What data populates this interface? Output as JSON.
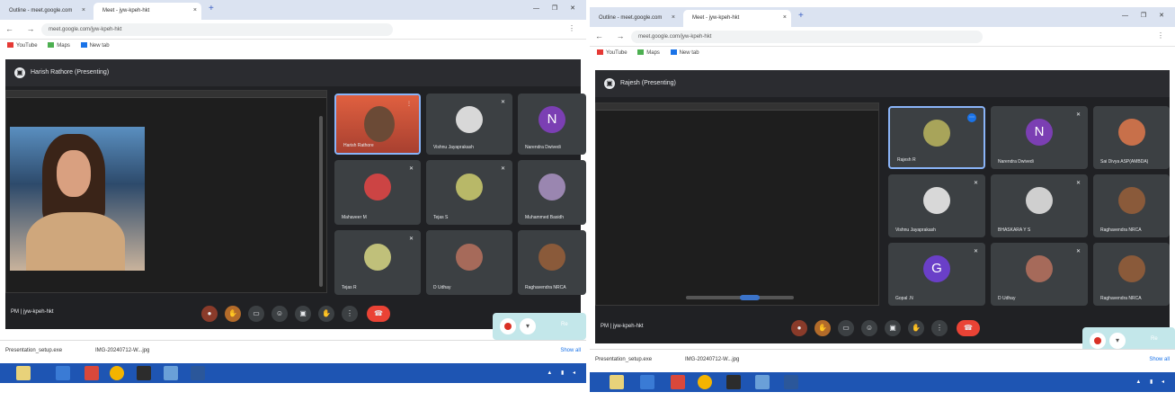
{
  "left": {
    "tabs": [
      {
        "label": "Outline - meet.google.com",
        "active": false
      },
      {
        "label": "Meet - jyw-kpeh-hkt",
        "active": true
      }
    ],
    "url": "meet.google.com/jyw-kpeh-hkt",
    "bookmarks": [
      "YouTube",
      "Maps",
      "New tab"
    ],
    "presenter_title": "Harish Rathore (Presenting)",
    "participants": [
      {
        "name": "Harish Rathore",
        "selected": true
      },
      {
        "name": "Vishnu Jayaprakash",
        "selected": false
      },
      {
        "name": "Narendra Dwivedi",
        "selected": false,
        "initial": "N",
        "color": "#7b3fb3"
      },
      {
        "name": "Mahaveer M",
        "selected": false
      },
      {
        "name": "Tejas S",
        "selected": false
      },
      {
        "name": "Muhammed Basidh",
        "selected": false
      },
      {
        "name": "Tejas R",
        "selected": false
      },
      {
        "name": "D Udhay",
        "selected": false
      },
      {
        "name": "Raghavendra NRCA",
        "selected": false
      }
    ],
    "meeting_code": "PM | jyw-kpeh-hkt",
    "recording_label": "Re",
    "download": "Presentation_setup.exe",
    "download2": "IMG-20240712-W...jpg",
    "show_all": "Show all"
  },
  "right": {
    "tabs": [
      {
        "label": "Outline - meet.google.com",
        "active": false
      },
      {
        "label": "Meet - jyw-kpeh-hkt",
        "active": true
      }
    ],
    "url": "meet.google.com/jyw-kpeh-hkt",
    "bookmarks": [
      "YouTube",
      "Maps",
      "New tab"
    ],
    "presenter_title": "Rajesh (Presenting)",
    "participants": [
      {
        "name": "Rajesh R",
        "selected": true
      },
      {
        "name": "Narendra Dwivedi",
        "selected": false,
        "initial": "N",
        "color": "#7b3fb3"
      },
      {
        "name": "Sai Divya ASP(AMBDA)",
        "selected": false
      },
      {
        "name": "Vishnu Jayaprakash",
        "selected": false
      },
      {
        "name": "BHASKARA Y S",
        "selected": false
      },
      {
        "name": "Raghavendra NRCA",
        "selected": false
      },
      {
        "name": "Gopal .N",
        "selected": false,
        "initial": "G",
        "color": "#6a3fc8"
      },
      {
        "name": "D Udhay",
        "selected": false
      },
      {
        "name": "Raghavendra NRCA",
        "selected": false
      }
    ],
    "meeting_code": "PM | jyw-kpeh-hkt",
    "recording_label": "Re",
    "download": "Presentation_setup.exe",
    "download2": "IMG-20240712-W...jpg",
    "show_all": "Show all"
  },
  "icons": {
    "tab_close": "×",
    "new_tab": "+",
    "nav": "← → ⟳",
    "window": "— ❐ ✕",
    "mic_off": "🎤",
    "more": "⋮"
  },
  "colors": {
    "meet_bg": "#202124",
    "tile_bg": "#3c4043",
    "end_call": "#ea4335",
    "selected_border": "#8ab4f8",
    "taskbar": "#1e55b3"
  }
}
